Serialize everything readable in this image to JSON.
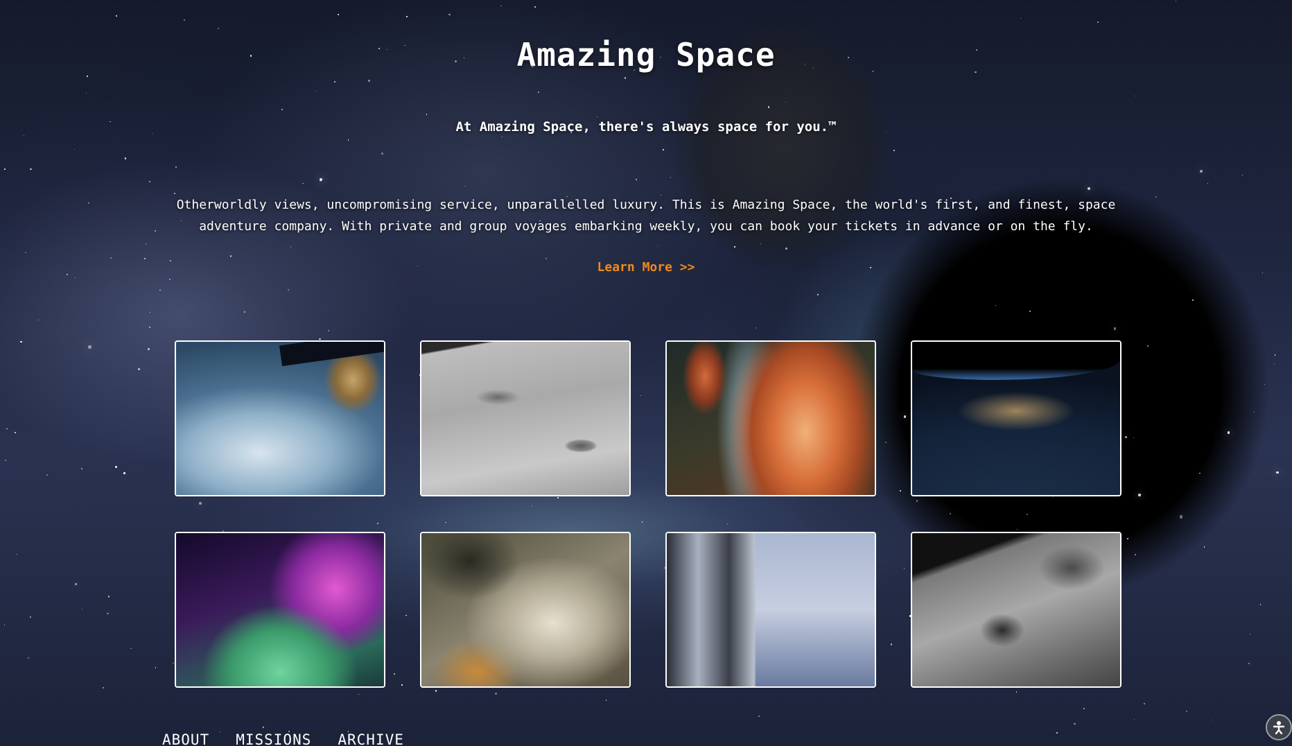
{
  "header": {
    "title": "Amazing Space",
    "tagline": "At Amazing Space, there's always space for you.™"
  },
  "intro": {
    "line1": "Otherworldly views, uncompromising service, unparallelled luxury. This is Amazing Space, the world's first, and finest, space",
    "line2": "adventure company. With private and group voyages embarking weekly, you can book your tickets in advance or on the fly.",
    "cta_label": "Learn More >>"
  },
  "nav": {
    "items": [
      "ABOUT",
      "MISSIONS",
      "ARCHIVE"
    ]
  },
  "colors": {
    "accent": "#f08a1c",
    "text": "#ffffff"
  },
  "icons": {
    "corner_button": "accessibility-icon"
  }
}
